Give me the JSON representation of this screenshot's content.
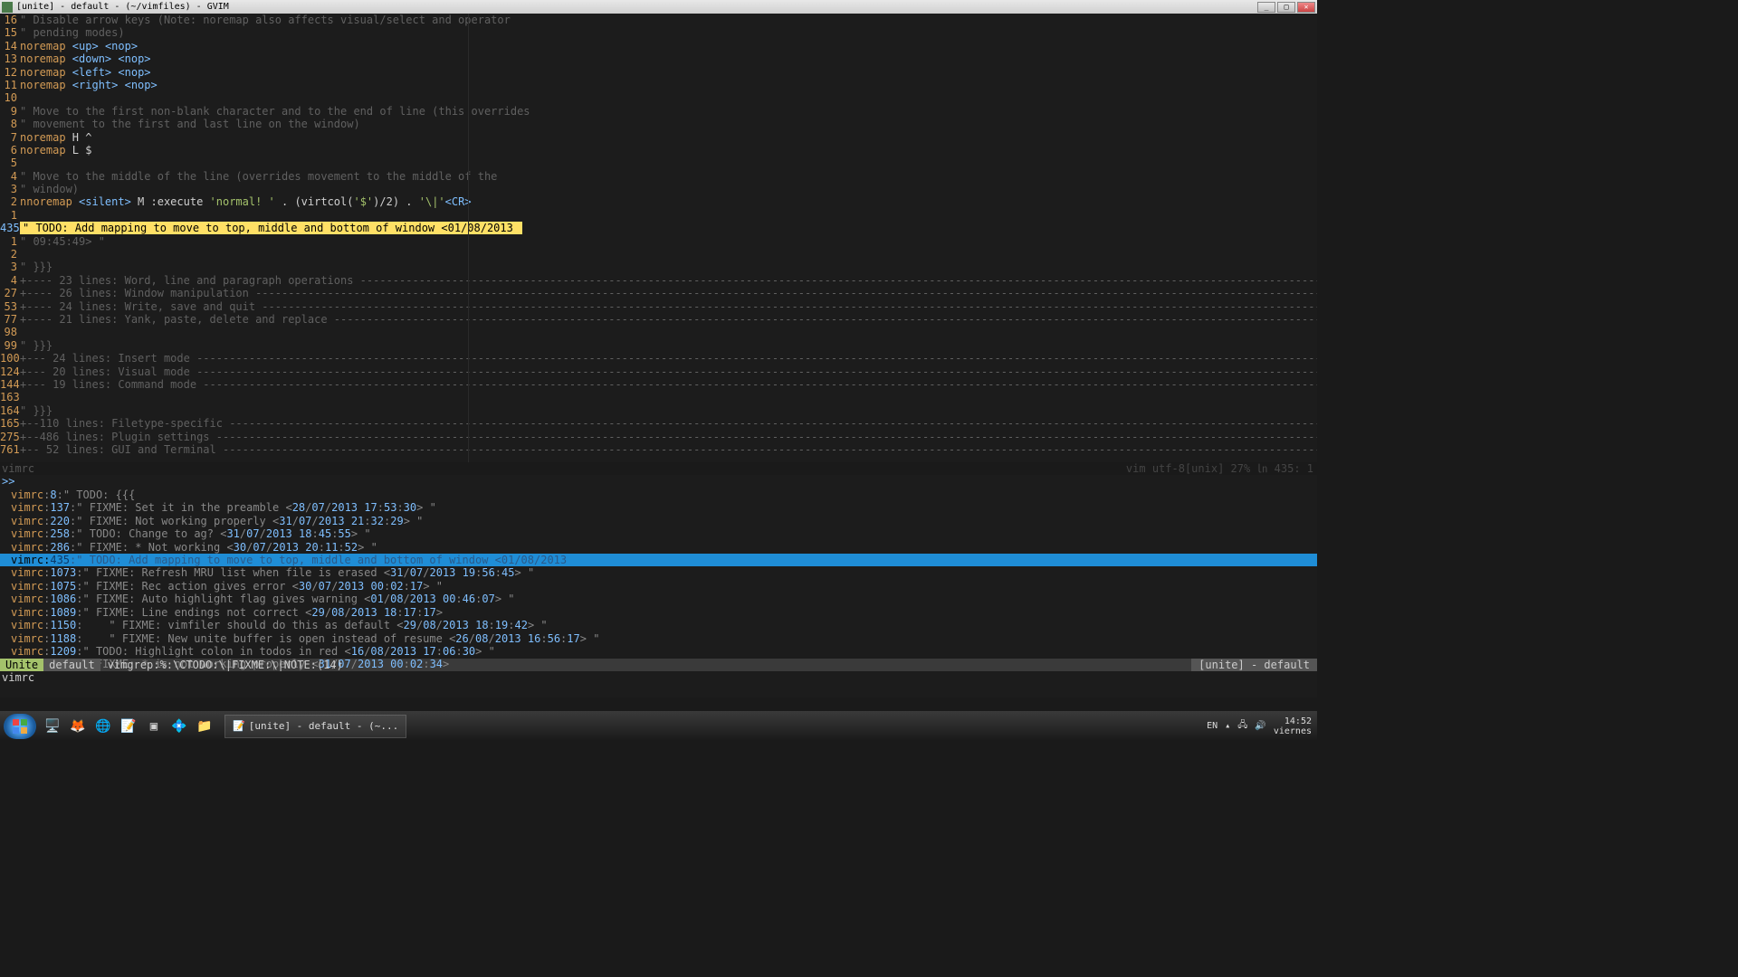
{
  "window": {
    "title": "[unite] - default - (~/vimfiles) - GVIM"
  },
  "editor": {
    "lines": [
      {
        "n": "16",
        "seg": [
          {
            "c": "comment",
            "t": "\" Disable arrow keys (Note: noremap also affects visual/select and operator"
          }
        ]
      },
      {
        "n": "15",
        "seg": [
          {
            "c": "comment",
            "t": "\" pending modes)"
          }
        ]
      },
      {
        "n": "14",
        "seg": [
          {
            "c": "keyword",
            "t": "noremap "
          },
          {
            "c": "special",
            "t": "<up>"
          },
          {
            "c": "",
            "t": " "
          },
          {
            "c": "special",
            "t": "<nop>"
          }
        ]
      },
      {
        "n": "13",
        "seg": [
          {
            "c": "keyword",
            "t": "noremap "
          },
          {
            "c": "special",
            "t": "<down>"
          },
          {
            "c": "",
            "t": " "
          },
          {
            "c": "special",
            "t": "<nop>"
          }
        ]
      },
      {
        "n": "12",
        "seg": [
          {
            "c": "keyword",
            "t": "noremap "
          },
          {
            "c": "special",
            "t": "<left>"
          },
          {
            "c": "",
            "t": " "
          },
          {
            "c": "special",
            "t": "<nop>"
          }
        ]
      },
      {
        "n": "11",
        "seg": [
          {
            "c": "keyword",
            "t": "noremap "
          },
          {
            "c": "special",
            "t": "<right>"
          },
          {
            "c": "",
            "t": " "
          },
          {
            "c": "special",
            "t": "<nop>"
          }
        ]
      },
      {
        "n": "10",
        "seg": []
      },
      {
        "n": "9",
        "seg": [
          {
            "c": "comment",
            "t": "\" Move to the first non-blank character and to the end of line (this overrides"
          }
        ]
      },
      {
        "n": "8",
        "seg": [
          {
            "c": "comment",
            "t": "\" movement to the first and last line on the window)"
          }
        ]
      },
      {
        "n": "7",
        "seg": [
          {
            "c": "keyword",
            "t": "noremap "
          },
          {
            "c": "",
            "t": "H ^"
          }
        ]
      },
      {
        "n": "6",
        "seg": [
          {
            "c": "keyword",
            "t": "noremap "
          },
          {
            "c": "",
            "t": "L $"
          }
        ]
      },
      {
        "n": "5",
        "seg": []
      },
      {
        "n": "4",
        "seg": [
          {
            "c": "comment",
            "t": "\" Move to the middle of the line (overrides movement to the middle of the"
          }
        ]
      },
      {
        "n": "3",
        "seg": [
          {
            "c": "comment",
            "t": "\" window)"
          }
        ]
      },
      {
        "n": "2",
        "seg": [
          {
            "c": "keyword",
            "t": "nnoremap "
          },
          {
            "c": "special",
            "t": "<silent>"
          },
          {
            "c": "",
            "t": " M :execute "
          },
          {
            "c": "string",
            "t": "'normal! '"
          },
          {
            "c": "",
            "t": " . (virtcol("
          },
          {
            "c": "string",
            "t": "'$'"
          },
          {
            "c": "",
            "t": ")/2) . "
          },
          {
            "c": "string",
            "t": "'\\|'"
          },
          {
            "c": "special",
            "t": "<CR>"
          }
        ]
      },
      {
        "n": "1",
        "seg": []
      },
      {
        "n": "435",
        "cur": true,
        "seg": [
          {
            "c": "hl-yellow",
            "t": "\" TODO: Add mapping to move to top, middle and bottom of window <01/08/2013 "
          }
        ]
      },
      {
        "n": "1",
        "seg": [
          {
            "c": "comment",
            "t": "\" 09:45:49> \""
          }
        ]
      },
      {
        "n": "2",
        "seg": []
      },
      {
        "n": "3",
        "seg": [
          {
            "c": "comment",
            "t": "\" }}}"
          }
        ]
      },
      {
        "n": "4",
        "fold": "+---- 23 lines: Word, line and paragraph operations "
      },
      {
        "n": "27",
        "fold": "+---- 26 lines: Window manipulation "
      },
      {
        "n": "53",
        "fold": "+---- 24 lines: Write, save and quit "
      },
      {
        "n": "77",
        "fold": "+---- 21 lines: Yank, paste, delete and replace "
      },
      {
        "n": "98",
        "seg": []
      },
      {
        "n": "99",
        "seg": [
          {
            "c": "comment",
            "t": "\" }}}"
          }
        ]
      },
      {
        "n": "100",
        "fold": "+--- 24 lines: Insert mode "
      },
      {
        "n": "124",
        "fold": "+--- 20 lines: Visual mode "
      },
      {
        "n": "144",
        "fold": "+--- 19 lines: Command mode "
      },
      {
        "n": "163",
        "seg": []
      },
      {
        "n": "164",
        "seg": [
          {
            "c": "comment",
            "t": "\" }}}"
          }
        ]
      },
      {
        "n": "165",
        "fold": "+--110 lines: Filetype-specific "
      },
      {
        "n": "275",
        "fold": "+--486 lines: Plugin settings "
      },
      {
        "n": "761",
        "fold": "+-- 52 lines: GUI and Terminal "
      }
    ],
    "buftab": "vimrc",
    "status_right": "vim   utf-8[unix]     27% ㏑ 435:  1"
  },
  "unite": {
    "prompt": ">>",
    "items": [
      {
        "file": "vimrc",
        "ln": "8",
        "body": ":\" TODO: {{{",
        "date": "",
        "sel": false
      },
      {
        "file": "vimrc",
        "ln": "137",
        "body": ":\" FIXME: Set it in the preamble <",
        "date": "28/07/2013 17:53:30",
        "tail": "> \"",
        "sel": false
      },
      {
        "file": "vimrc",
        "ln": "220",
        "body": ":\" FIXME: Not working properly <",
        "date": "31/07/2013 21:32:29",
        "tail": "> \"",
        "sel": false
      },
      {
        "file": "vimrc",
        "ln": "258",
        "body": ":\" TODO: Change to ag? <",
        "date": "31/07/2013 18:45:55",
        "tail": "> \"",
        "sel": false
      },
      {
        "file": "vimrc",
        "ln": "286",
        "body": ":\" FIXME: * Not working <",
        "date": "30/07/2013 20:11:52",
        "tail": "> \"",
        "sel": false
      },
      {
        "file": "vimrc",
        "ln": "435",
        "body": ":\" TODO: Add mapping to move to top, middle and bottom of window <01/08/2013",
        "date": "",
        "tail": "",
        "sel": true
      },
      {
        "file": "vimrc",
        "ln": "1073",
        "body": ":\" FIXME: Refresh MRU list when file is erased <",
        "date": "31/07/2013 19:56:45",
        "tail": "> \"",
        "sel": false
      },
      {
        "file": "vimrc",
        "ln": "1075",
        "body": ":\" FIXME: Rec action gives error <",
        "date": "30/07/2013 00:02:17",
        "tail": "> \"",
        "sel": false
      },
      {
        "file": "vimrc",
        "ln": "1086",
        "body": ":\" FIXME: Auto highlight flag gives warning <",
        "date": "01/08/2013 00:46:07",
        "tail": "> \"",
        "sel": false
      },
      {
        "file": "vimrc",
        "ln": "1089",
        "body": ":\" FIXME: Line endings not correct <",
        "date": "29/08/2013 18:17:17",
        "tail": ">",
        "sel": false
      },
      {
        "file": "vimrc",
        "ln": "1150",
        "body": ":    \" FIXME: vimfiler should do this as default <",
        "date": "29/08/2013 18:19:42",
        "tail": "> \"",
        "sel": false
      },
      {
        "file": "vimrc",
        "ln": "1188",
        "body": ":    \" FIXME: New unite buffer is open instead of resume <",
        "date": "26/08/2013 16:56:17",
        "tail": "> \"",
        "sel": false
      },
      {
        "file": "vimrc",
        "ln": "1209",
        "body": ":\" TODO: Highlight colon in todos in red <",
        "date": "16/08/2013 17:06:30",
        "tail": "> \"",
        "sel": false
      },
      {
        "file": "vimrc",
        "ln": "1307",
        "body": ":\" FIXME: * is not working properly <",
        "date": "31/07/2013 00:02:34",
        "tail": ">",
        "sel": false
      }
    ],
    "status": {
      "chip1": "Unite",
      "chip2": "default",
      "text": "vimgrep:%:\\CTODO:\\|FIXME:\\|NOTE:(14)",
      "right": "[unite] - default"
    }
  },
  "cmdline": "vimrc",
  "taskbar": {
    "task": "[unite] - default - (~...",
    "lang": "EN",
    "time": "14:52",
    "date": "viernes"
  }
}
